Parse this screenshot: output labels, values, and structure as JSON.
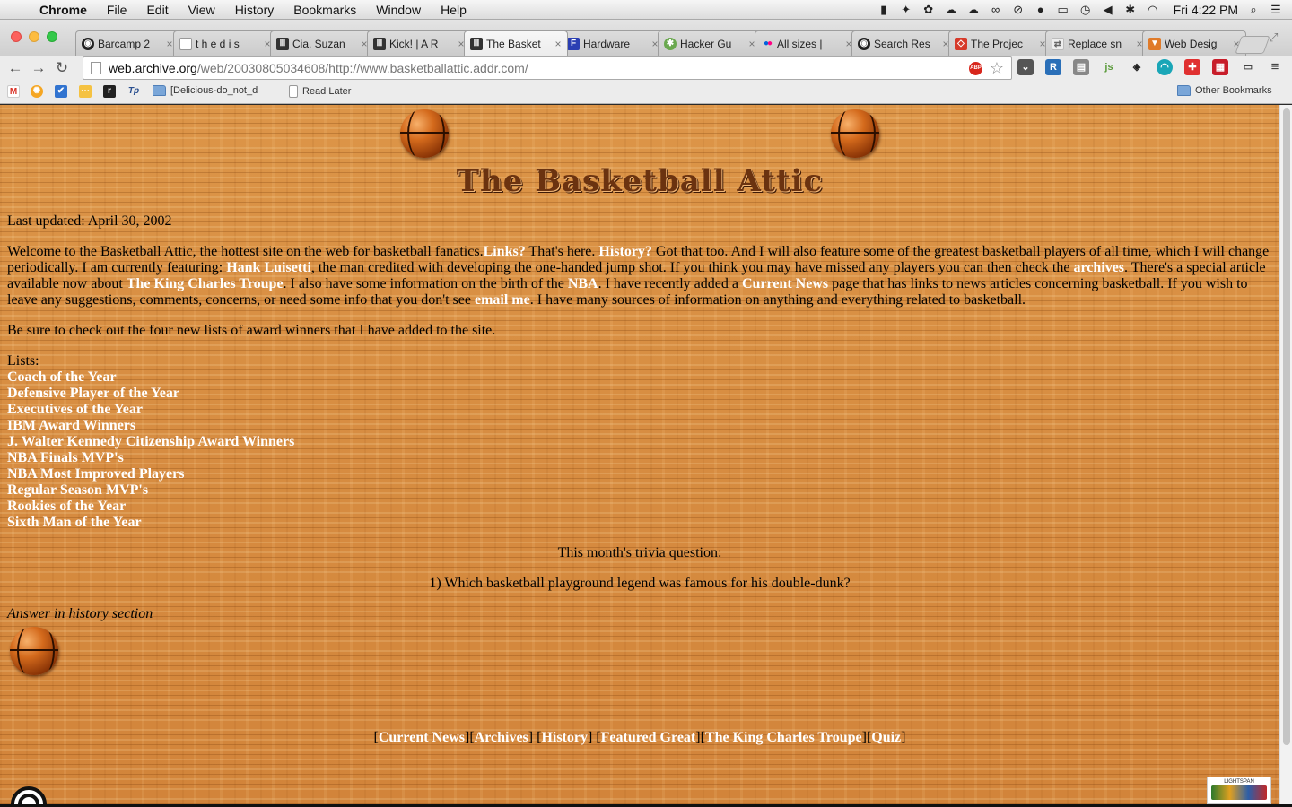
{
  "menubar": {
    "app": "Chrome",
    "items": [
      "File",
      "Edit",
      "View",
      "History",
      "Bookmarks",
      "Window",
      "Help"
    ],
    "clock": "Fri 4:22 PM"
  },
  "tabs": [
    {
      "title": "Barcamp 2",
      "icon": "github-icon",
      "active": false
    },
    {
      "title": "t h e   d i s",
      "icon": "page-icon",
      "active": false
    },
    {
      "title": "Cia. Suzan",
      "icon": "archive-icon",
      "active": false
    },
    {
      "title": "Kick! | A R",
      "icon": "archive-icon",
      "active": false
    },
    {
      "title": "The Basket",
      "icon": "archive-icon",
      "active": true
    },
    {
      "title": "Hardware",
      "icon": "hardware-icon",
      "active": false
    },
    {
      "title": "Hacker Gu",
      "icon": "hacker-icon",
      "active": false
    },
    {
      "title": "All sizes |",
      "icon": "flickr-icon",
      "active": false
    },
    {
      "title": "Search Res",
      "icon": "github-icon",
      "active": false
    },
    {
      "title": "The Projec",
      "icon": "project-icon",
      "active": false
    },
    {
      "title": "Replace sn",
      "icon": "replace-icon",
      "active": false
    },
    {
      "title": "Web Desig",
      "icon": "webdesign-icon",
      "active": false
    }
  ],
  "address": {
    "host": "web.archive.org",
    "path": "/web/20030805034608/http://www.basketballattic.addr.com/"
  },
  "bookmarks": {
    "folder1": "[Delicious-do_not_d",
    "read_later": "Read Later",
    "other": "Other Bookmarks"
  },
  "page": {
    "title": "The Basketball Attic",
    "last_updated": "Last updated: April 30, 2002",
    "intro": {
      "t1": "Welcome to the Basketball Attic, the hottest site on the web for basketball fanatics.",
      "l_links": "Links?",
      "t2": " That's here. ",
      "l_history": "History?",
      "t3": " Got that too. And I will also feature some of the greatest basketball players of all time, which I will change periodically. I am currently featuring: ",
      "l_hank": "Hank Luisetti",
      "t4": ", the man credited with developing the one-handed jump shot. If you think you may have missed any players you can then check the ",
      "l_archives": "archives",
      "t5": ". There's a special article available now about ",
      "l_kct": "The King Charles Troupe",
      "t6": ". I also have some information on the birth of the ",
      "l_nba": "NBA",
      "t7": ". I have recently added a ",
      "l_news": "Current News",
      "t8": " page that has links to news articles concerning basketball. If you wish to leave any suggestions, comments, concerns, or need some info that you don't see ",
      "l_email": "email me",
      "t9": ". I have many sources of information on anything and everything related to basketball."
    },
    "award_note": "Be sure to check out the four new lists of award winners that I have added to the site.",
    "lists_label": "Lists:",
    "lists": [
      "Coach of the Year",
      "Defensive Player of the Year",
      "Executives of the Year",
      "IBM Award Winners",
      "J. Walter Kennedy Citizenship Award Winners",
      "NBA Finals MVP's",
      "NBA Most Improved Players",
      "Regular Season MVP's",
      "Rookies of the Year",
      "Sixth Man of the Year"
    ],
    "trivia_heading": "This month's trivia question:",
    "trivia_question": "1) Which basketball playground legend was famous for his double-dunk?",
    "answer_note": "Answer in history section",
    "footer_nav": [
      "Current News",
      "Archives",
      "History",
      "Featured Great",
      "The King Charles Troupe",
      "Quiz"
    ],
    "badge": {
      "top": "LIGHTSPAN"
    }
  },
  "colors": {
    "link": "#ffffff",
    "title": "#6b3310",
    "wood": "#d88a3c"
  }
}
